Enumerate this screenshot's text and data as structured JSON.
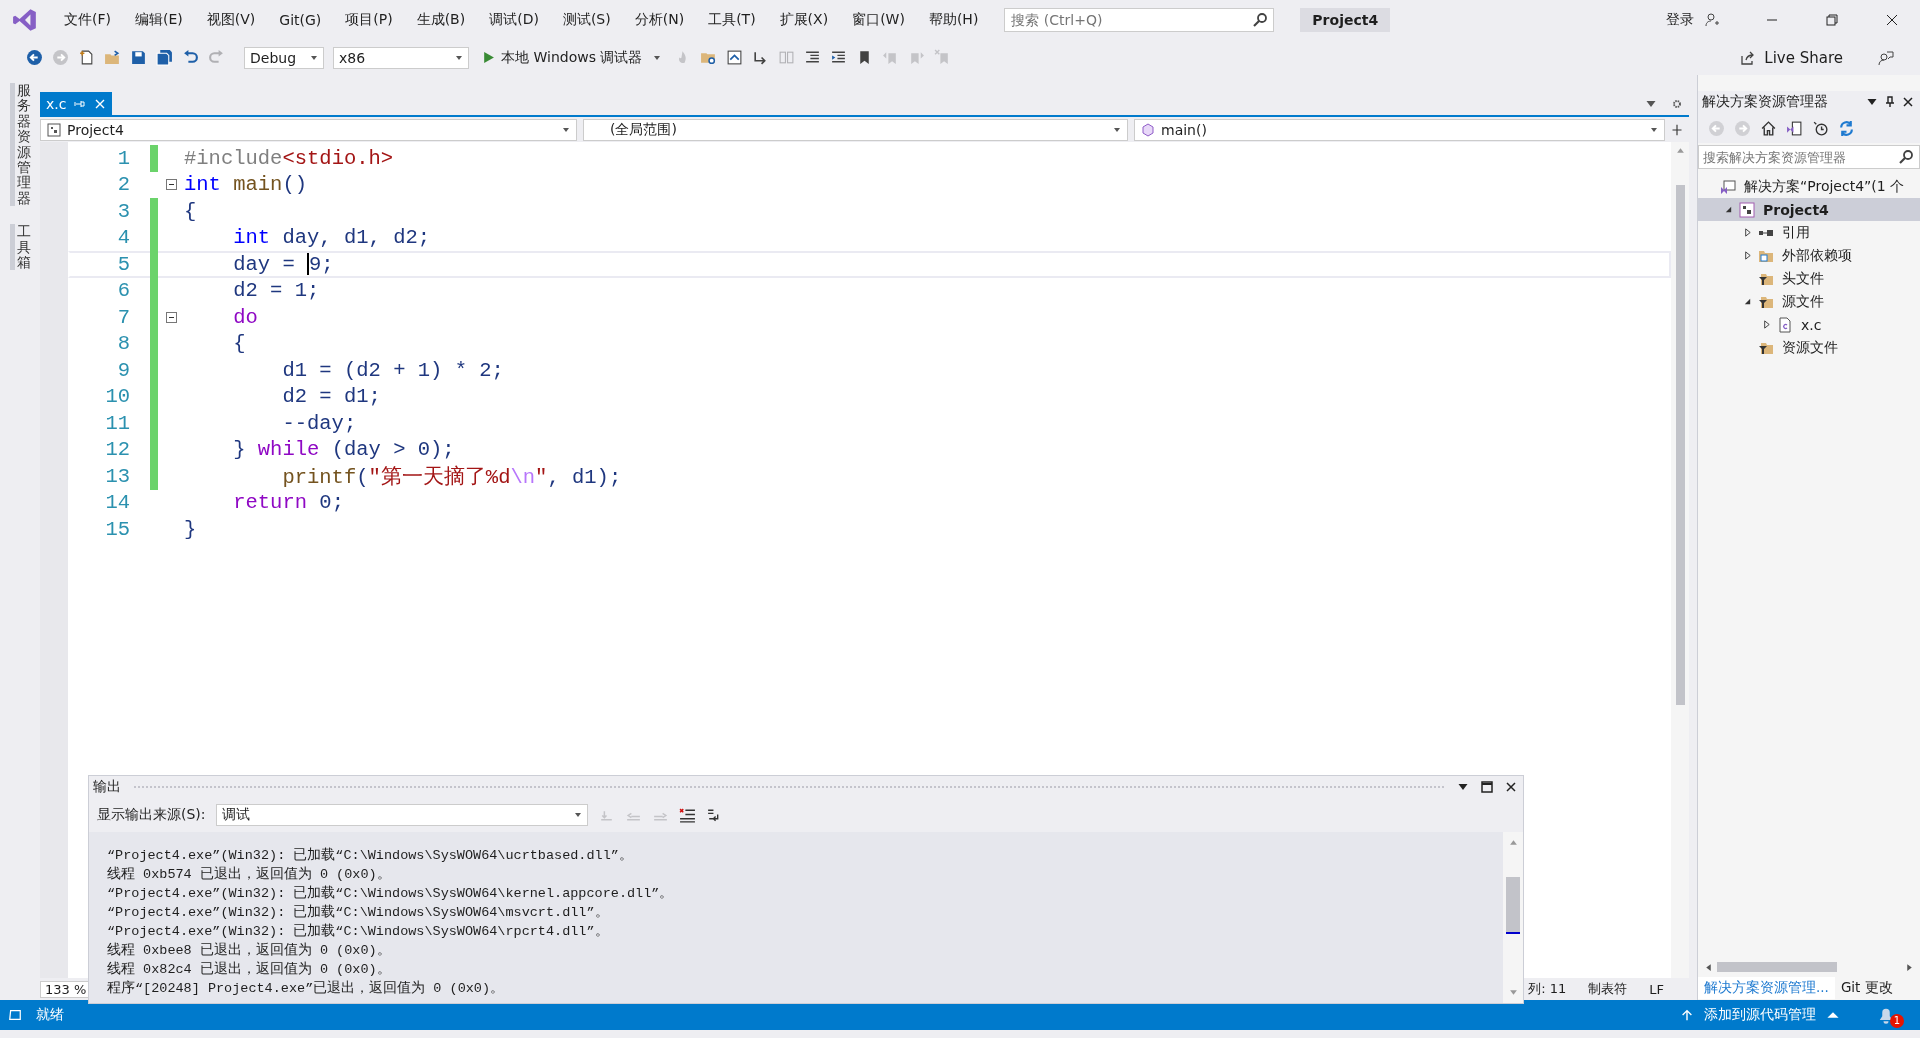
{
  "menu": [
    "文件(F)",
    "编辑(E)",
    "视图(V)",
    "Git(G)",
    "项目(P)",
    "生成(B)",
    "调试(D)",
    "测试(S)",
    "分析(N)",
    "工具(T)",
    "扩展(X)",
    "窗口(W)",
    "帮助(H)"
  ],
  "search": {
    "placeholder": "搜索 (Ctrl+Q)"
  },
  "title": "Project4",
  "account": "登录",
  "toolbar": {
    "configuration": "Debug",
    "platform": "x86",
    "run": "本地 Windows 调试器",
    "live_share": "Live Share"
  },
  "side_tabs": [
    "服务器资源管理器",
    "工具箱"
  ],
  "editor": {
    "tabs": [
      {
        "label": "x.c",
        "selected": true
      }
    ],
    "nav": {
      "project": "Project4",
      "scope": "(全局范围)",
      "member": "main()"
    },
    "lines": [
      {
        "number": "1",
        "changed": true,
        "foldable": false,
        "current": false,
        "tokens": [
          {
            "kind": "preproc",
            "text": "#include"
          },
          {
            "kind": "string",
            "text": "<stdio.h>"
          }
        ]
      },
      {
        "number": "2",
        "changed": false,
        "foldable": true,
        "current": false,
        "tokens": [
          {
            "kind": "keyword",
            "text": "int"
          },
          {
            "kind": "func",
            "text": " main"
          },
          {
            "kind": "plain",
            "text": "()"
          }
        ]
      },
      {
        "number": "3",
        "changed": true,
        "foldable": false,
        "current": false,
        "tokens": [
          {
            "kind": "plain",
            "text": "{"
          }
        ]
      },
      {
        "number": "4",
        "changed": true,
        "foldable": false,
        "current": false,
        "tokens": [
          {
            "kind": "keyword",
            "text": "    int"
          },
          {
            "kind": "plain",
            "text": " day, d1, d2;"
          }
        ]
      },
      {
        "number": "5",
        "changed": true,
        "foldable": false,
        "current": true,
        "tokens": [
          {
            "kind": "plain",
            "text": "    day = "
          },
          {
            "kind": "plain",
            "text": "9",
            "caret": true
          },
          {
            "kind": "plain",
            "text": ";"
          }
        ]
      },
      {
        "number": "6",
        "changed": true,
        "foldable": false,
        "current": false,
        "tokens": [
          {
            "kind": "plain",
            "text": "    d2 = 1;"
          }
        ]
      },
      {
        "number": "7",
        "changed": true,
        "foldable": true,
        "current": false,
        "tokens": [
          {
            "kind": "control",
            "text": "    do"
          }
        ]
      },
      {
        "number": "8",
        "changed": true,
        "foldable": false,
        "current": false,
        "tokens": [
          {
            "kind": "plain",
            "text": "    {"
          }
        ]
      },
      {
        "number": "9",
        "changed": true,
        "foldable": false,
        "current": false,
        "tokens": [
          {
            "kind": "plain",
            "text": "        d1 = (d2 + 1) * 2;"
          }
        ]
      },
      {
        "number": "10",
        "changed": true,
        "foldable": false,
        "current": false,
        "tokens": [
          {
            "kind": "plain",
            "text": "        d2 = d1;"
          }
        ]
      },
      {
        "number": "11",
        "changed": true,
        "foldable": false,
        "current": false,
        "tokens": [
          {
            "kind": "plain",
            "text": "        --day;"
          }
        ]
      },
      {
        "number": "12",
        "changed": true,
        "foldable": false,
        "current": false,
        "tokens": [
          {
            "kind": "plain",
            "text": "    } "
          },
          {
            "kind": "control",
            "text": "while"
          },
          {
            "kind": "plain",
            "text": " (day > 0);"
          }
        ]
      },
      {
        "number": "13",
        "changed": true,
        "foldable": false,
        "current": false,
        "tokens": [
          {
            "kind": "func",
            "text": "        printf"
          },
          {
            "kind": "plain",
            "text": "("
          },
          {
            "kind": "string",
            "text": "\"第一天摘了%d"
          },
          {
            "kind": "escape",
            "text": "\\n"
          },
          {
            "kind": "string",
            "text": "\""
          },
          {
            "kind": "plain",
            "text": ", d1);"
          }
        ]
      },
      {
        "number": "14",
        "changed": false,
        "foldable": false,
        "current": false,
        "tokens": [
          {
            "kind": "control",
            "text": "    return"
          },
          {
            "kind": "plain",
            "text": " 0;"
          }
        ]
      },
      {
        "number": "15",
        "changed": false,
        "foldable": false,
        "current": false,
        "tokens": [
          {
            "kind": "plain",
            "text": "}"
          }
        ]
      }
    ],
    "zoom": "133 %",
    "column": "列: 11",
    "indent": "制表符",
    "line_ending": "LF"
  },
  "output": {
    "title": "输出",
    "source_label": "显示输出来源(S):",
    "source": "调试",
    "lines": [
      "“Project4.exe”(Win32): 已加载“C:\\Windows\\SysWOW64\\ucrtbased.dll”。",
      "线程 0xb574 已退出，返回值为 0 (0x0)。",
      "“Project4.exe”(Win32): 已加载“C:\\Windows\\SysWOW64\\kernel.appcore.dll”。",
      "“Project4.exe”(Win32): 已加载“C:\\Windows\\SysWOW64\\msvcrt.dll”。",
      "“Project4.exe”(Win32): 已加载“C:\\Windows\\SysWOW64\\rpcrt4.dll”。",
      "线程 0xbee8 已退出，返回值为 0 (0x0)。",
      "线程 0x82c4 已退出，返回值为 0 (0x0)。",
      "程序“[20248] Project4.exe”已退出，返回值为 0 (0x0)。"
    ]
  },
  "solution_explorer": {
    "title": "解决方案资源管理器",
    "search": {
      "placeholder": "搜索解决方案资源管理器"
    },
    "tree": [
      {
        "label": "解决方案“Project4”(1 个",
        "kind": "solution",
        "expandable": false,
        "selected": false,
        "children": [
          {
            "label": "Project4",
            "kind": "project",
            "expandable": true,
            "expanded": true,
            "selected": true,
            "children": [
              {
                "label": "引用",
                "kind": "references",
                "expandable": true,
                "expanded": false,
                "selected": false
              },
              {
                "label": "外部依赖项",
                "kind": "external",
                "expandable": true,
                "expanded": false,
                "selected": false
              },
              {
                "label": "头文件",
                "kind": "filter",
                "expandable": false,
                "selected": false
              },
              {
                "label": "源文件",
                "kind": "filter",
                "expandable": true,
                "expanded": true,
                "selected": false,
                "children": [
                  {
                    "label": "x.c",
                    "kind": "file",
                    "expandable": true,
                    "expanded": false,
                    "selected": false
                  }
                ]
              },
              {
                "label": "资源文件",
                "kind": "filter",
                "expandable": false,
                "selected": false
              }
            ]
          }
        ]
      }
    ],
    "tabs": [
      {
        "label": "解决方案资源管理...",
        "selected": true
      },
      {
        "label": "Git 更改",
        "selected": false
      }
    ]
  },
  "status_bar": {
    "ready": "就绪",
    "source_control": "添加到源代码管理",
    "notifications": "1"
  }
}
